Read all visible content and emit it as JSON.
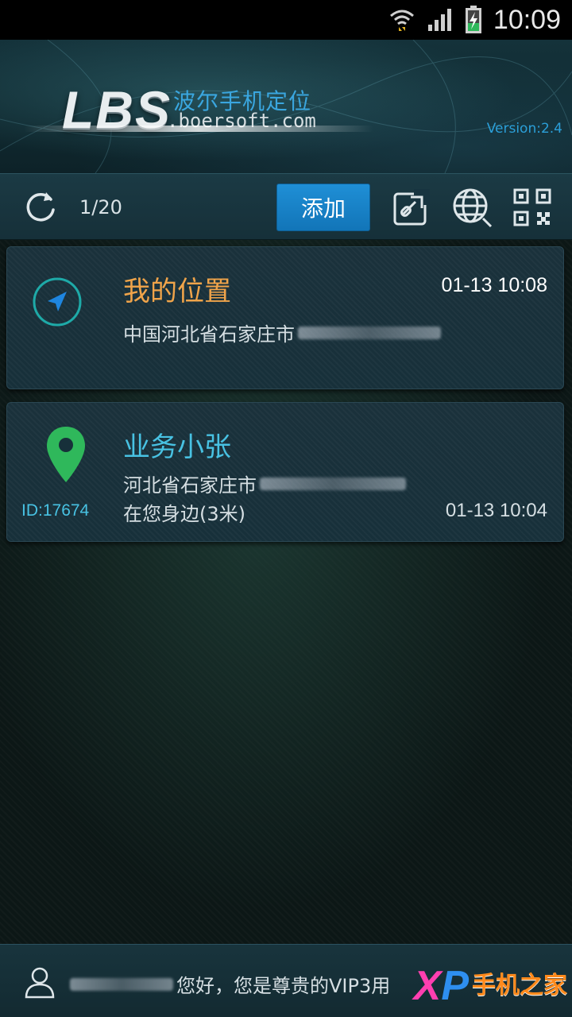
{
  "status_bar": {
    "time": "10:09"
  },
  "header": {
    "logo_text": "LBS",
    "logo_cn": "波尔手机定位",
    "logo_domain": ".boersoft.com",
    "version": "Version:2.4"
  },
  "toolbar": {
    "count": "1/20",
    "add_label": "添加"
  },
  "cards": [
    {
      "name": "我的位置",
      "time": "01-13 10:08",
      "address": "中国河北省石家庄市"
    },
    {
      "name": "业务小张",
      "id_label": "ID:17674",
      "address": "河北省石家庄市",
      "distance": "在您身边(3米)",
      "time": "01-13 10:04"
    }
  ],
  "bottom_bar": {
    "greeting": "您好，您是尊贵的VIP3用"
  },
  "watermark": {
    "x": "X",
    "p": "P",
    "text": "手机之家"
  },
  "colors": {
    "accent_blue": "#1f8fd6",
    "my_location_name": "#f0a44a",
    "contact_name": "#48c2e3",
    "pin_green": "#2fb85b"
  }
}
